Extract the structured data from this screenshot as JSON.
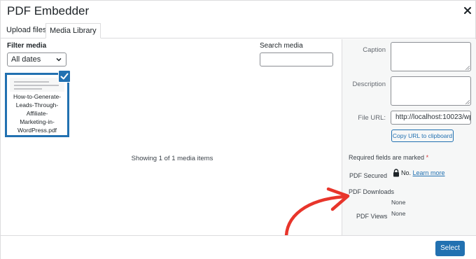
{
  "modal": {
    "title": "PDF Embedder",
    "close_icon": "close-icon"
  },
  "tabs": [
    {
      "label": "Upload files",
      "active": false
    },
    {
      "label": "Media Library",
      "active": true
    }
  ],
  "filter": {
    "label": "Filter media",
    "selected": "All dates"
  },
  "search": {
    "label": "Search media",
    "value": ""
  },
  "attachment": {
    "filename_lines": [
      "How-to-Generate-",
      "Leads-Through-",
      "Affiliate-",
      "Marketing-in-",
      "WordPress.pdf"
    ],
    "selected": true
  },
  "status": {
    "showing": "Showing 1 of 1 media items"
  },
  "details": {
    "caption_label": "Caption",
    "caption_value": "",
    "description_label": "Description",
    "description_value": "",
    "file_url_label": "File URL:",
    "file_url_value": "http://localhost:10023/wp",
    "copy_button": "Copy URL to clipboard",
    "required_text": "Required fields are marked",
    "required_star": "*",
    "pdf_secured_label": "PDF Secured",
    "pdf_secured_value": "No.",
    "learn_more": "Learn more",
    "pdf_downloads_label": "PDF Downloads",
    "pdf_downloads_value": "None",
    "pdf_views_label": "PDF Views",
    "pdf_views_value": "None"
  },
  "footer": {
    "select_button": "Select"
  },
  "colors": {
    "accent": "#2271b1",
    "arrow": "#e8352b",
    "sidebar_bg": "#f6f7f7",
    "required": "#d63638"
  }
}
